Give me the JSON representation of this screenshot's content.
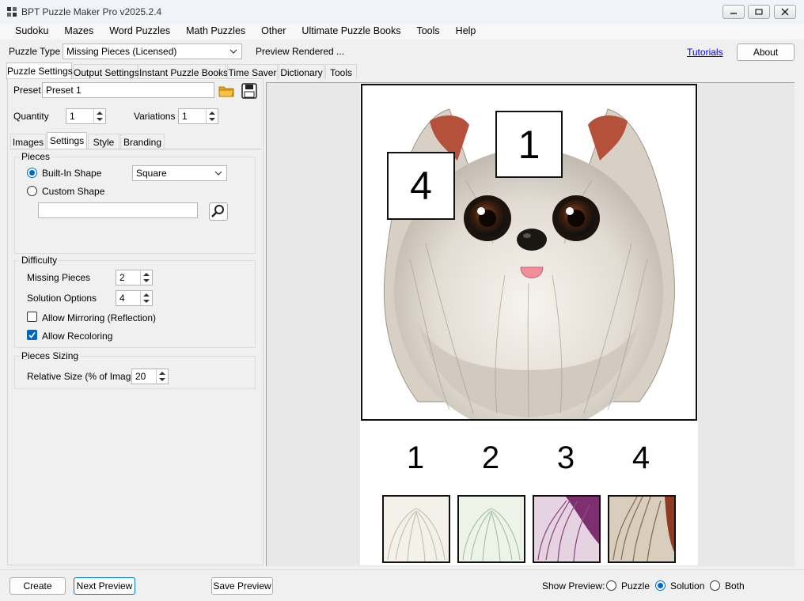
{
  "window": {
    "title": "BPT Puzzle Maker Pro v2025.2.4"
  },
  "menu": [
    "Sudoku",
    "Mazes",
    "Word Puzzles",
    "Math Puzzles",
    "Other",
    "Ultimate Puzzle Books",
    "Tools",
    "Help"
  ],
  "toolbar": {
    "puzzle_type_label": "Puzzle Type",
    "puzzle_type_value": "Missing Pieces (Licensed)",
    "status": "Preview Rendered ...",
    "tutorials_link": "Tutorials",
    "about_button": "About"
  },
  "main_tabs": [
    "Puzzle Settings",
    "Output Settings",
    "Instant Puzzle Books",
    "Time Saver",
    "Dictionary",
    "Tools"
  ],
  "settings": {
    "preset_label": "Preset",
    "preset_value": "Preset 1",
    "quantity_label": "Quantity",
    "quantity_value": "1",
    "variations_label": "Variations",
    "variations_value": "1"
  },
  "sub_tabs": [
    "Images",
    "Settings",
    "Style",
    "Branding"
  ],
  "pieces": {
    "title": "Pieces",
    "builtin_label": "Built-In Shape",
    "builtin_shape": "Square",
    "custom_label": "Custom Shape",
    "custom_value": ""
  },
  "difficulty": {
    "title": "Difficulty",
    "missing_label": "Missing Pieces",
    "missing_value": "2",
    "solution_label": "Solution Options",
    "solution_value": "4",
    "mirroring_label": "Allow Mirroring (Reflection)",
    "mirroring_checked": false,
    "recoloring_label": "Allow Recoloring",
    "recoloring_checked": true
  },
  "sizing": {
    "title": "Pieces Sizing",
    "relative_label": "Relative Size (% of Image)",
    "relative_value": "20"
  },
  "preview": {
    "missing_boxes": [
      "1",
      "4"
    ],
    "option_numbers": [
      "1",
      "2",
      "3",
      "4"
    ]
  },
  "bottom": {
    "create": "Create",
    "next_preview": "Next Preview",
    "save_preview": "Save Preview",
    "show_preview_label": "Show Preview:",
    "opt_puzzle": "Puzzle",
    "opt_solution": "Solution",
    "opt_both": "Both",
    "selected": "Solution"
  },
  "colors": {
    "accent": "#0067c0",
    "link": "#0000ee"
  }
}
